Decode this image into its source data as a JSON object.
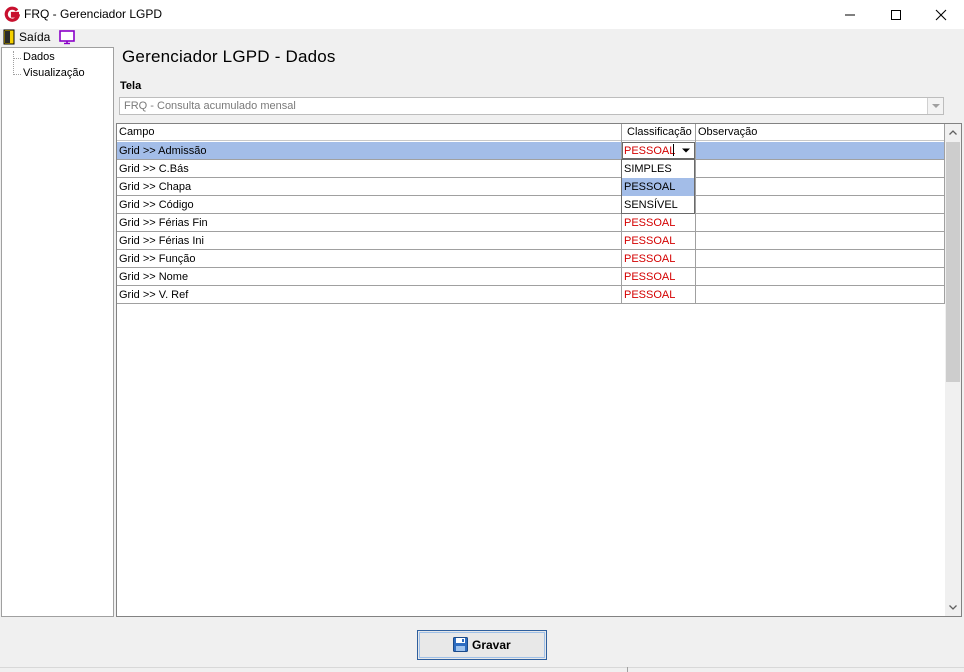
{
  "window": {
    "title": "FRQ - Gerenciador LGPD"
  },
  "toolbar": {
    "exit_label": "Saída",
    "exit_icon": "door-exit-icon",
    "monitor_icon": "monitor-icon"
  },
  "tree": {
    "items": [
      "Dados",
      "Visualização"
    ]
  },
  "main": {
    "title": "Gerenciador LGPD - Dados",
    "tela_label": "Tela",
    "tela_value": "FRQ - Consulta acumulado mensal"
  },
  "grid": {
    "headers": [
      "Campo",
      "Classificação",
      "Observação"
    ],
    "rows": [
      {
        "campo": "Grid >> Admissão",
        "classificacao": "PESSOAL",
        "observacao": ""
      },
      {
        "campo": "Grid >> C.Bás",
        "classificacao": "",
        "observacao": ""
      },
      {
        "campo": "Grid >> Chapa",
        "classificacao": "",
        "observacao": ""
      },
      {
        "campo": "Grid >> Código",
        "classificacao": "",
        "observacao": ""
      },
      {
        "campo": "Grid >> Férias Fin",
        "classificacao": "PESSOAL",
        "observacao": ""
      },
      {
        "campo": "Grid >> Férias Ini",
        "classificacao": "PESSOAL",
        "observacao": ""
      },
      {
        "campo": "Grid >> Função",
        "classificacao": "PESSOAL",
        "observacao": ""
      },
      {
        "campo": "Grid >> Nome",
        "classificacao": "PESSOAL",
        "observacao": ""
      },
      {
        "campo": "Grid >> V. Ref",
        "classificacao": "PESSOAL",
        "observacao": ""
      }
    ],
    "dropdown": {
      "current": "PESSOAL",
      "options": [
        "SIMPLES",
        "PESSOAL",
        "SENSÍVEL"
      ],
      "highlighted": "PESSOAL"
    }
  },
  "footer": {
    "save_label": "Gravar"
  },
  "colors": {
    "selection": "#a3bde8",
    "classification_text": "#d40000",
    "brand_icon": "#c8102e"
  }
}
